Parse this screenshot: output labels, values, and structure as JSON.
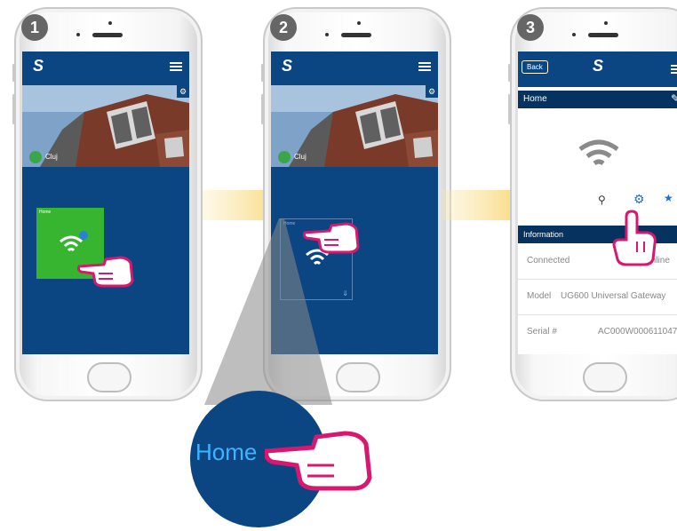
{
  "steps": [
    "1",
    "2",
    "3"
  ],
  "screen1": {
    "location_name": "Cluj",
    "tile_label": "Home"
  },
  "screen2": {
    "location_name": "Cluj",
    "tile_label": "Home"
  },
  "zoom": {
    "label": "Home"
  },
  "screen3": {
    "back_label": "Back",
    "title": "Home",
    "section_header": "Information",
    "rows": [
      {
        "label": "Connected",
        "value": "Online"
      },
      {
        "label": "Model",
        "value": "UG600 Universal Gateway"
      },
      {
        "label": "Serial #",
        "value": "AC000W000611047"
      }
    ]
  },
  "colors": {
    "app_blue": "#0b4682",
    "header_dark": "#06325f",
    "tile_green": "#37b531",
    "hand_pink": "#d8186f",
    "arrow_yellow": "#f6c840",
    "badge_gray": "#666666"
  },
  "icons": [
    "settings-gear-icon",
    "wifi-icon",
    "menu-icon",
    "pencil-icon",
    "pin-icon",
    "search-icon",
    "checkmark-icon",
    "pointing-hand-icon"
  ]
}
